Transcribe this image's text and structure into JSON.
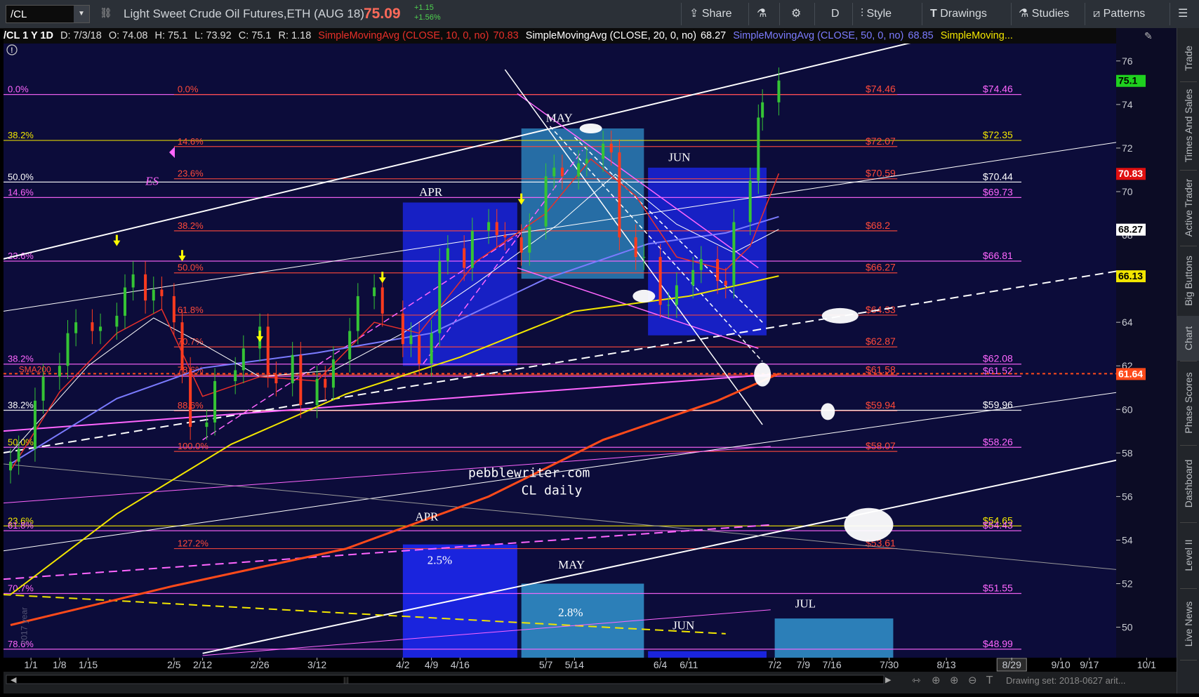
{
  "toolbar": {
    "symbol": "/CL",
    "description": "Light Sweet Crude Oil Futures,ETH (AUG 18)",
    "last_price": "75.09",
    "change": "+1.15",
    "change_pct": "+1.56%",
    "buttons": {
      "share": "Share",
      "flask": "",
      "settings": "",
      "period": "D",
      "style": "Style",
      "drawings": "Drawings",
      "studies": "Studies",
      "patterns": "Patterns"
    }
  },
  "info_bar": {
    "symbol_period": "/CL 1 Y 1D",
    "date": "D: 7/3/18",
    "open": "O: 74.08",
    "high": "H: 75.1",
    "low": "L: 73.92",
    "close": "C: 75.1",
    "range": "R: 1.18",
    "sma10": {
      "label": "SimpleMovingAvg (CLOSE, 10, 0, no)",
      "value": "70.83",
      "color": "#e8302a"
    },
    "sma20": {
      "label": "SimpleMovingAvg (CLOSE, 20, 0, no)",
      "value": "68.27",
      "color": "#ffffff"
    },
    "sma50": {
      "label": "SimpleMovingAvg (CLOSE, 50, 0, no)",
      "value": "68.85",
      "color": "#7b7bff"
    },
    "sma_more": {
      "label": "SimpleMoving...",
      "color": "#f2e600"
    }
  },
  "sidebar": [
    "Trade",
    "Times And Sales",
    "Active Trader",
    "Big Buttons",
    "Chart",
    "Phase Scores",
    "Dashboard",
    "Level II",
    "Live News"
  ],
  "scrollbar": {
    "drawing_set": "Drawing set: 2018-0627 arit..."
  },
  "colors": {
    "background": "#0c0c3a",
    "toolbar": "#2b3037",
    "price_up": "#4fd34f",
    "price_down": "#ff6a5a",
    "candle_up": "#35c435",
    "candle_down": "#ff3b1f",
    "sma10": "#e8302a",
    "sma20": "#ffffff",
    "sma50": "#7b7bff",
    "sma100": "#f2e600",
    "sma200": "#ff4a1a",
    "fib_red": "#ff4a3a",
    "fib_magenta": "#ff66ff",
    "fib_white": "#ffffff",
    "fib_yellow": "#f2e600",
    "box_blue": "#1a24dd",
    "box_teal": "#2c7fb8"
  },
  "chart_data": {
    "type": "candlestick",
    "symbol": "/CL",
    "period": "1 Y 1D",
    "ylim": [
      48.6,
      76.8
    ],
    "y_ticks": [
      50,
      52,
      54,
      56,
      58,
      60,
      62,
      64,
      66,
      68,
      70,
      72,
      74,
      76
    ],
    "x_range": [
      "2017-12-27",
      "2018-10-01"
    ],
    "x_ticks": [
      {
        "date": "2018-01-01",
        "label": "1/1"
      },
      {
        "date": "2018-01-08",
        "label": "1/8"
      },
      {
        "date": "2018-01-15",
        "label": "1/15"
      },
      {
        "date": "2018-02-05",
        "label": "2/5"
      },
      {
        "date": "2018-02-12",
        "label": "2/12"
      },
      {
        "date": "2018-02-26",
        "label": "2/26"
      },
      {
        "date": "2018-03-12",
        "label": "3/12"
      },
      {
        "date": "2018-04-02",
        "label": "4/2"
      },
      {
        "date": "2018-04-09",
        "label": "4/9"
      },
      {
        "date": "2018-04-16",
        "label": "4/16"
      },
      {
        "date": "2018-05-07",
        "label": "5/7"
      },
      {
        "date": "2018-05-14",
        "label": "5/14"
      },
      {
        "date": "2018-06-04",
        "label": "6/4"
      },
      {
        "date": "2018-06-11",
        "label": "6/11"
      },
      {
        "date": "2018-07-02",
        "label": "7/2"
      },
      {
        "date": "2018-07-09",
        "label": "7/9"
      },
      {
        "date": "2018-07-16",
        "label": "7/16"
      },
      {
        "date": "2018-07-30",
        "label": "7/30"
      },
      {
        "date": "2018-08-13",
        "label": "8/13"
      },
      {
        "date": "2018-08-29",
        "label": "8/29"
      },
      {
        "date": "2018-09-10",
        "label": "9/10"
      },
      {
        "date": "2018-09-17",
        "label": "9/17"
      },
      {
        "date": "2018-10-01",
        "label": "10/1"
      }
    ],
    "candles_close": [
      {
        "date": "2017-12-27",
        "c": 57.6
      },
      {
        "date": "2017-12-29",
        "c": 58.2
      },
      {
        "date": "2018-01-02",
        "c": 60.4
      },
      {
        "date": "2018-01-04",
        "c": 61.5
      },
      {
        "date": "2018-01-08",
        "c": 62.0
      },
      {
        "date": "2018-01-10",
        "c": 63.5
      },
      {
        "date": "2018-01-12",
        "c": 64.0
      },
      {
        "date": "2018-01-16",
        "c": 63.6
      },
      {
        "date": "2018-01-18",
        "c": 63.8
      },
      {
        "date": "2018-01-22",
        "c": 64.3
      },
      {
        "date": "2018-01-24",
        "c": 65.6
      },
      {
        "date": "2018-01-26",
        "c": 66.2
      },
      {
        "date": "2018-01-29",
        "c": 65.0
      },
      {
        "date": "2018-01-31",
        "c": 65.5
      },
      {
        "date": "2018-02-02",
        "c": 65.2
      },
      {
        "date": "2018-02-05",
        "c": 64.0
      },
      {
        "date": "2018-02-07",
        "c": 61.8
      },
      {
        "date": "2018-02-09",
        "c": 59.2
      },
      {
        "date": "2018-02-13",
        "c": 59.4
      },
      {
        "date": "2018-02-15",
        "c": 61.3
      },
      {
        "date": "2018-02-20",
        "c": 61.8
      },
      {
        "date": "2018-02-22",
        "c": 62.8
      },
      {
        "date": "2018-02-26",
        "c": 63.8
      },
      {
        "date": "2018-02-28",
        "c": 61.6
      },
      {
        "date": "2018-03-02",
        "c": 61.2
      },
      {
        "date": "2018-03-06",
        "c": 62.5
      },
      {
        "date": "2018-03-08",
        "c": 60.2
      },
      {
        "date": "2018-03-12",
        "c": 61.4
      },
      {
        "date": "2018-03-14",
        "c": 61.0
      },
      {
        "date": "2018-03-16",
        "c": 62.3
      },
      {
        "date": "2018-03-20",
        "c": 63.6
      },
      {
        "date": "2018-03-22",
        "c": 65.2
      },
      {
        "date": "2018-03-26",
        "c": 65.6
      },
      {
        "date": "2018-03-28",
        "c": 64.4
      },
      {
        "date": "2018-04-02",
        "c": 63.0
      },
      {
        "date": "2018-04-04",
        "c": 63.4
      },
      {
        "date": "2018-04-06",
        "c": 62.1
      },
      {
        "date": "2018-04-09",
        "c": 63.5
      },
      {
        "date": "2018-04-11",
        "c": 66.8
      },
      {
        "date": "2018-04-13",
        "c": 67.4
      },
      {
        "date": "2018-04-17",
        "c": 66.5
      },
      {
        "date": "2018-04-19",
        "c": 68.2
      },
      {
        "date": "2018-04-23",
        "c": 68.6
      },
      {
        "date": "2018-04-25",
        "c": 68.0
      },
      {
        "date": "2018-04-27",
        "c": 67.9
      },
      {
        "date": "2018-05-01",
        "c": 67.2
      },
      {
        "date": "2018-05-03",
        "c": 68.4
      },
      {
        "date": "2018-05-07",
        "c": 70.7
      },
      {
        "date": "2018-05-09",
        "c": 71.1
      },
      {
        "date": "2018-05-11",
        "c": 70.7
      },
      {
        "date": "2018-05-15",
        "c": 71.3
      },
      {
        "date": "2018-05-17",
        "c": 71.5
      },
      {
        "date": "2018-05-21",
        "c": 72.2
      },
      {
        "date": "2018-05-23",
        "c": 71.8
      },
      {
        "date": "2018-05-25",
        "c": 67.9
      },
      {
        "date": "2018-05-29",
        "c": 67.0
      },
      {
        "date": "2018-05-31",
        "c": 67.0
      },
      {
        "date": "2018-06-04",
        "c": 64.8
      },
      {
        "date": "2018-06-06",
        "c": 64.8
      },
      {
        "date": "2018-06-08",
        "c": 65.7
      },
      {
        "date": "2018-06-12",
        "c": 66.4
      },
      {
        "date": "2018-06-14",
        "c": 66.9
      },
      {
        "date": "2018-06-18",
        "c": 65.9
      },
      {
        "date": "2018-06-20",
        "c": 65.7
      },
      {
        "date": "2018-06-22",
        "c": 68.6
      },
      {
        "date": "2018-06-26",
        "c": 70.5
      },
      {
        "date": "2018-06-28",
        "c": 73.4
      },
      {
        "date": "2018-06-29",
        "c": 74.1
      },
      {
        "date": "2018-07-03",
        "c": 75.1
      }
    ],
    "moving_averages": [
      {
        "name": "SMA 10",
        "value": 70.83,
        "color": "#e8302a"
      },
      {
        "name": "SMA 20",
        "value": 68.27,
        "color": "#ffffff"
      },
      {
        "name": "SMA 50",
        "value": 66.13,
        "color": "#f2e600"
      },
      {
        "name": "SMA200",
        "value": 61.64,
        "color": "#ff4a1a"
      }
    ],
    "price_tags": [
      {
        "value": 75.1,
        "label": "75.1",
        "bg": "#1fd11f",
        "fg": "#000000"
      },
      {
        "value": 70.83,
        "label": "70.83",
        "bg": "#e01010",
        "fg": "#ffffff"
      },
      {
        "value": 68.27,
        "label": "68.27",
        "bg": "#ffffff",
        "fg": "#000000"
      },
      {
        "value": 66.13,
        "label": "66.13",
        "bg": "#f2e600",
        "fg": "#000000"
      },
      {
        "value": 61.64,
        "label": "61.64",
        "bg": "#ff4a1a",
        "fg": "#ffffff"
      }
    ],
    "horizontal_levels": [
      {
        "value": 74.46,
        "label": "$74.46",
        "color": "#ff66ff",
        "side": "right"
      },
      {
        "value": 74.46,
        "label": "$74.46",
        "color": "#ff4a3a",
        "side": "mid"
      },
      {
        "value": 72.35,
        "label": "$72.35",
        "color": "#f2e600",
        "side": "right"
      },
      {
        "value": 72.07,
        "label": "$72.07",
        "color": "#ff4a3a",
        "side": "mid"
      },
      {
        "value": 70.59,
        "label": "$70.59",
        "color": "#ff4a3a",
        "side": "mid"
      },
      {
        "value": 70.44,
        "label": "$70.44",
        "color": "#ffffff",
        "side": "right"
      },
      {
        "value": 69.73,
        "label": "$69.73",
        "color": "#ff66ff",
        "side": "right"
      },
      {
        "value": 68.2,
        "label": "$68.2",
        "color": "#ff4a3a",
        "side": "mid"
      },
      {
        "value": 66.81,
        "label": "$66.81",
        "color": "#ff66ff",
        "side": "right"
      },
      {
        "value": 66.27,
        "label": "$66.27",
        "color": "#ff4a3a",
        "side": "mid"
      },
      {
        "value": 64.33,
        "label": "$64.33",
        "color": "#ff4a3a",
        "side": "mid"
      },
      {
        "value": 62.87,
        "label": "$62.87",
        "color": "#ff4a3a",
        "side": "mid"
      },
      {
        "value": 62.08,
        "label": "$62.08",
        "color": "#ff66ff",
        "side": "right"
      },
      {
        "value": 61.58,
        "label": "$61.58",
        "color": "#ff4a3a",
        "side": "mid"
      },
      {
        "value": 61.52,
        "label": "$61.52",
        "color": "#ff66ff",
        "side": "right"
      },
      {
        "value": 59.94,
        "label": "$59.94",
        "color": "#ff4a3a",
        "side": "mid"
      },
      {
        "value": 59.96,
        "label": "$59.96",
        "color": "#ffffff",
        "side": "right"
      },
      {
        "value": 58.26,
        "label": "$58.26",
        "color": "#ff66ff",
        "side": "right"
      },
      {
        "value": 58.07,
        "label": "$58.07",
        "color": "#ff4a3a",
        "side": "mid"
      },
      {
        "value": 54.65,
        "label": "$54.65",
        "color": "#f2e600",
        "side": "right"
      },
      {
        "value": 54.43,
        "label": "$54.43",
        "color": "#ff66ff",
        "side": "right"
      },
      {
        "value": 53.61,
        "label": "$53.61",
        "color": "#ff4a3a",
        "side": "mid"
      },
      {
        "value": 51.55,
        "label": "$51.55",
        "color": "#ff66ff",
        "side": "right"
      },
      {
        "value": 48.99,
        "label": "$48.99",
        "color": "#ff66ff",
        "side": "right"
      }
    ],
    "fib_labels": [
      {
        "value": 74.46,
        "label": "0.0%",
        "color": "#ff66ff",
        "side": "left"
      },
      {
        "value": 72.35,
        "label": "38.2%",
        "color": "#f2e600",
        "side": "left"
      },
      {
        "value": 70.44,
        "label": "50.0%",
        "color": "#ffffff",
        "side": "left"
      },
      {
        "value": 69.73,
        "label": "14.6%",
        "color": "#ff66ff",
        "side": "left"
      },
      {
        "value": 66.81,
        "label": "23.6%",
        "color": "#ff66ff",
        "side": "left"
      },
      {
        "value": 62.08,
        "label": "38.2%",
        "color": "#ff66ff",
        "side": "left"
      },
      {
        "value": 59.96,
        "label": "38.2%",
        "color": "#ffffff",
        "side": "left"
      },
      {
        "value": 58.26,
        "label": "50.0%",
        "color": "#f2e600",
        "side": "left"
      },
      {
        "value": 54.65,
        "label": "23.6%",
        "color": "#f2e600",
        "side": "left"
      },
      {
        "value": 54.43,
        "label": "61.8%",
        "color": "#ff66ff",
        "side": "left"
      },
      {
        "value": 51.55,
        "label": "70.7%",
        "color": "#ff66ff",
        "side": "left"
      },
      {
        "value": 48.99,
        "label": "78.6%",
        "color": "#ff66ff",
        "side": "left"
      },
      {
        "value": 74.46,
        "label": "0.0%",
        "color": "#ff4a3a",
        "side": "inner"
      },
      {
        "value": 72.07,
        "label": "14.6%",
        "color": "#ff4a3a",
        "side": "inner"
      },
      {
        "value": 70.59,
        "label": "23.6%",
        "color": "#ff4a3a",
        "side": "inner"
      },
      {
        "value": 68.2,
        "label": "38.2%",
        "color": "#ff4a3a",
        "side": "inner"
      },
      {
        "value": 66.27,
        "label": "50.0%",
        "color": "#ff4a3a",
        "side": "inner"
      },
      {
        "value": 64.33,
        "label": "61.8%",
        "color": "#ff4a3a",
        "side": "inner"
      },
      {
        "value": 62.87,
        "label": "70.7%",
        "color": "#ff4a3a",
        "side": "inner"
      },
      {
        "value": 61.58,
        "label": "78.6%",
        "color": "#ff4a3a",
        "side": "inner"
      },
      {
        "value": 59.94,
        "label": "88.6%",
        "color": "#ff4a3a",
        "side": "inner"
      },
      {
        "value": 58.07,
        "label": "100.0%",
        "color": "#ff4a3a",
        "side": "inner"
      },
      {
        "value": 53.61,
        "label": "127.2%",
        "color": "#ff4a3a",
        "side": "inner"
      }
    ],
    "annotations": [
      {
        "text": "MAY",
        "color": "#ffffff"
      },
      {
        "text": "JUN",
        "color": "#ffffff"
      },
      {
        "text": "APR",
        "color": "#ffffff"
      },
      {
        "text": "ES",
        "color": "#ff66ff"
      },
      {
        "text": "SMA200",
        "color": "#ff4a3a"
      },
      {
        "text": "pebblewriter.com",
        "color": "#ffffff"
      },
      {
        "text": "CL daily",
        "color": "#ffffff"
      },
      {
        "text": "APR",
        "color": "#ffffff"
      },
      {
        "text": "2.5%",
        "color": "#ffffff"
      },
      {
        "text": "MAY",
        "color": "#ffffff"
      },
      {
        "text": "2.8%",
        "color": "#ffffff"
      },
      {
        "text": "JUN",
        "color": "#ffffff"
      },
      {
        "text": "JUL",
        "color": "#ffffff"
      },
      {
        "text": "2017 year",
        "color": "#555577"
      }
    ]
  }
}
